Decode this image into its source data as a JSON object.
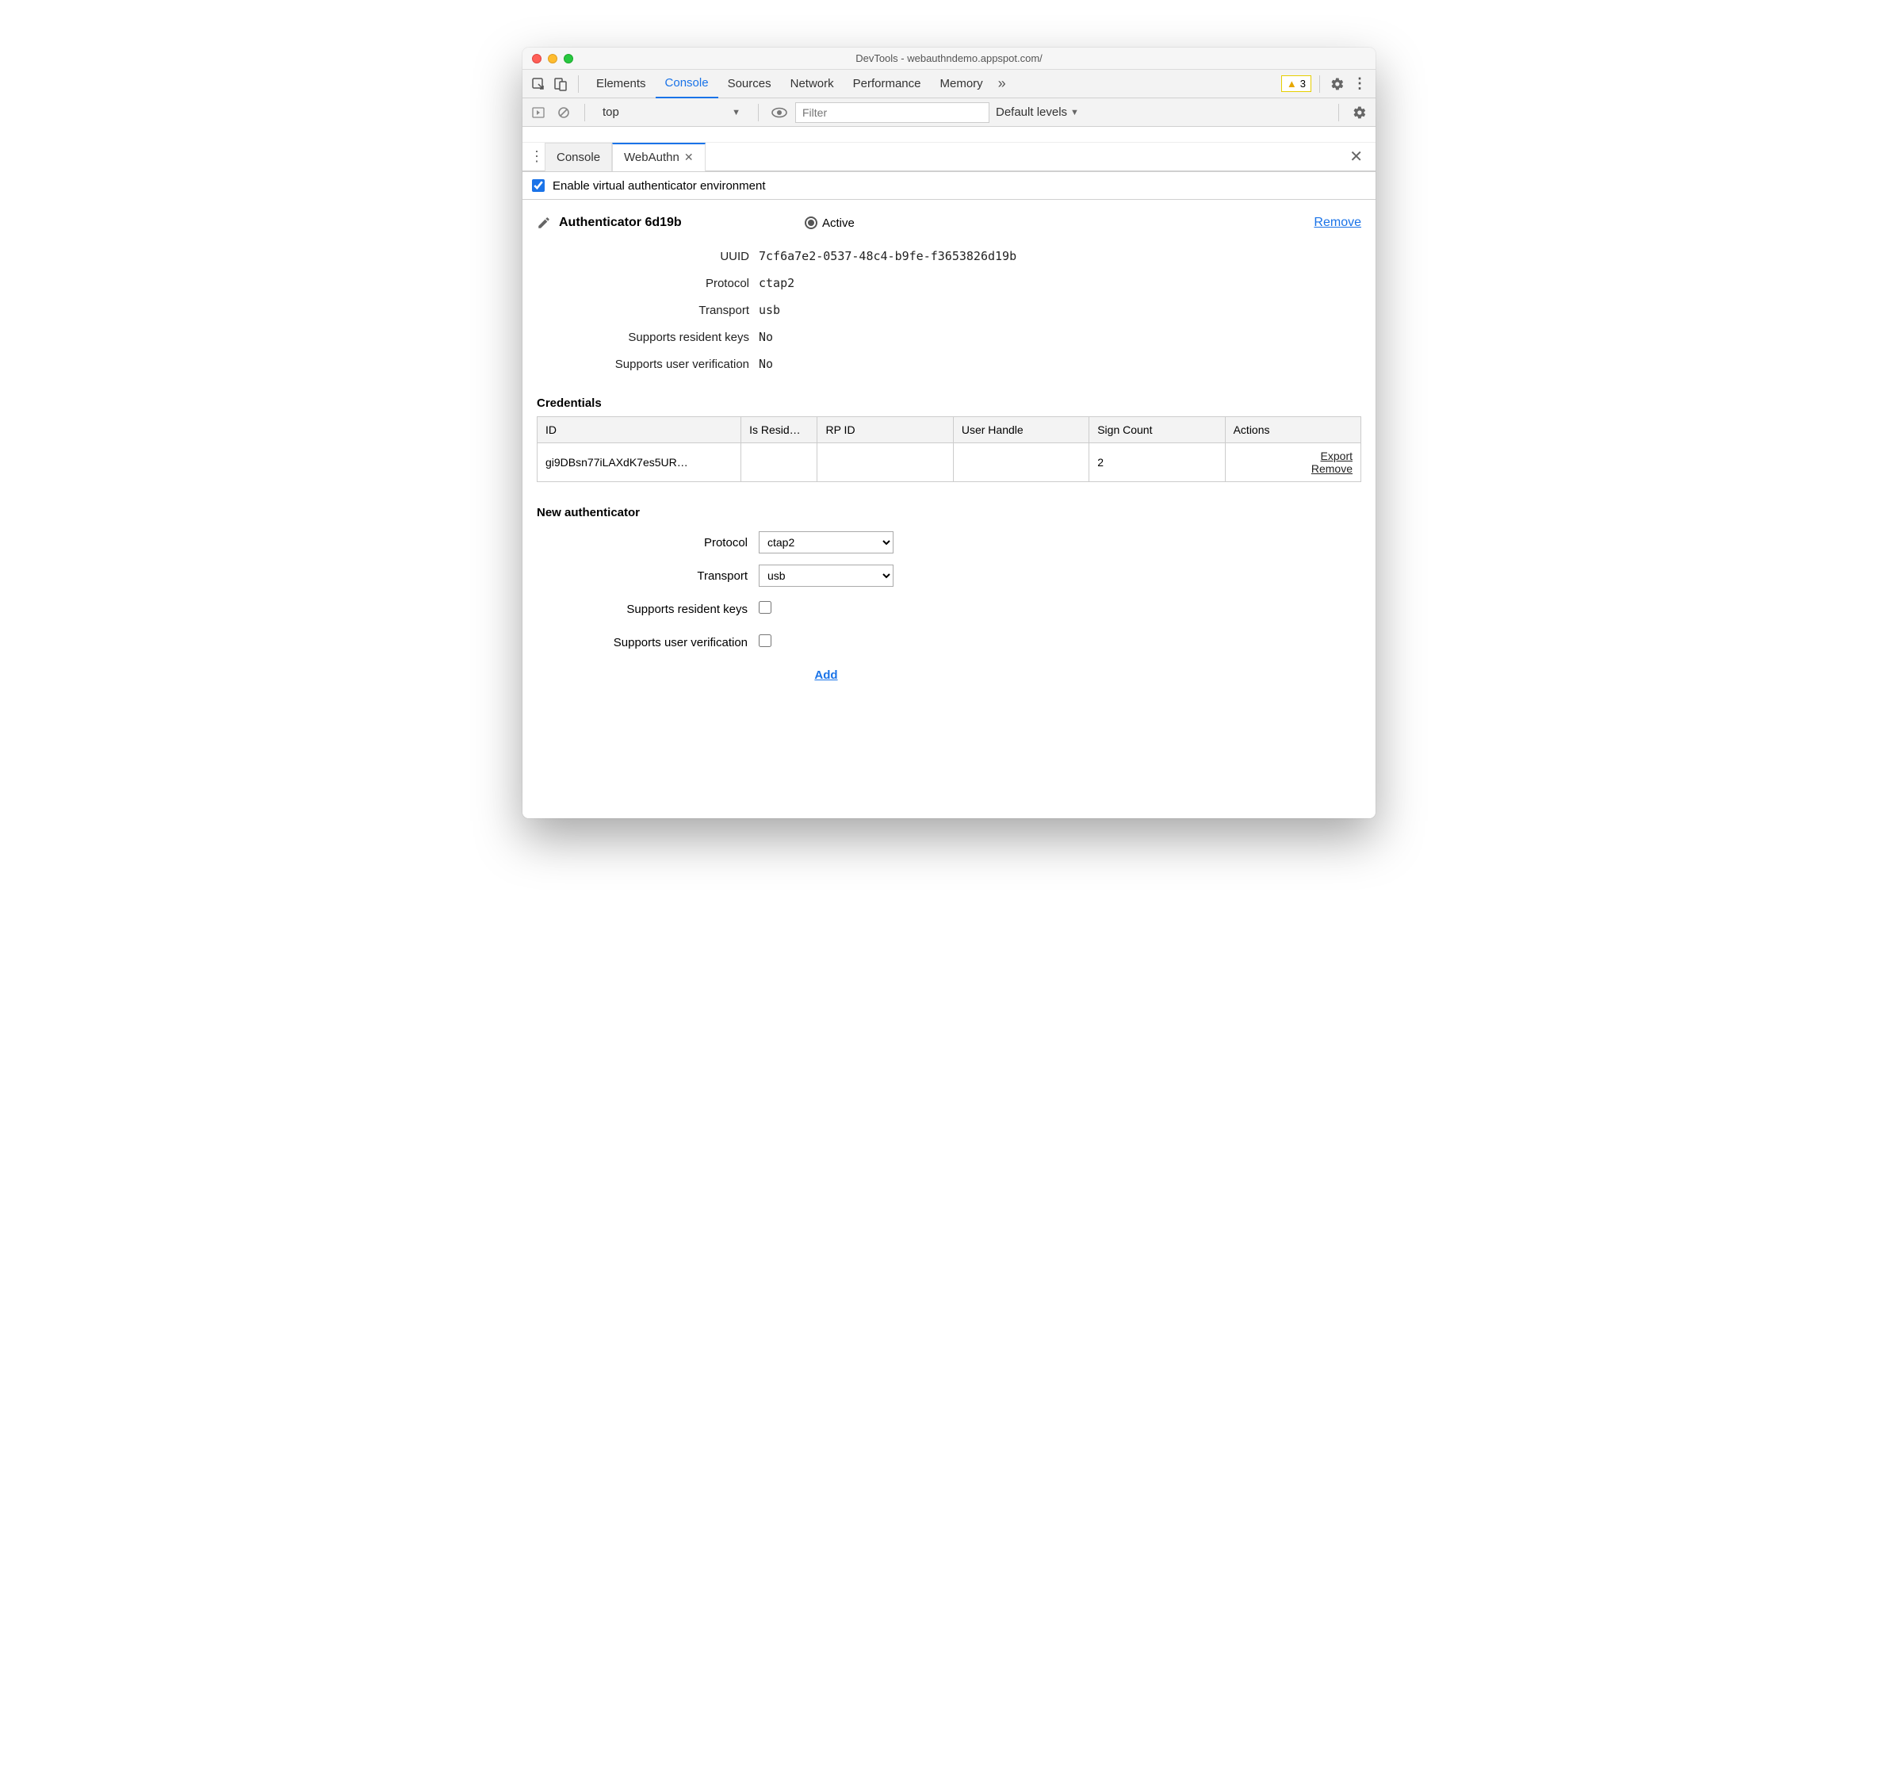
{
  "window": {
    "title": "DevTools - webauthndemo.appspot.com/"
  },
  "main_tabs": [
    "Elements",
    "Console",
    "Sources",
    "Network",
    "Performance",
    "Memory"
  ],
  "main_tab_active_index": 1,
  "issues_count": "3",
  "console_bar": {
    "context": "top",
    "filter_placeholder": "Filter",
    "levels": "Default levels"
  },
  "drawer": {
    "tabs": [
      "Console",
      "WebAuthn"
    ],
    "active_index": 1
  },
  "enable_checkbox": {
    "label": "Enable virtual authenticator environment",
    "checked": true
  },
  "authenticator": {
    "title": "Authenticator 6d19b",
    "active_label": "Active",
    "remove_label": "Remove",
    "details": [
      {
        "label": "UUID",
        "value": "7cf6a7e2-0537-48c4-b9fe-f3653826d19b"
      },
      {
        "label": "Protocol",
        "value": "ctap2"
      },
      {
        "label": "Transport",
        "value": "usb"
      },
      {
        "label": "Supports resident keys",
        "value": "No"
      },
      {
        "label": "Supports user verification",
        "value": "No"
      }
    ]
  },
  "credentials": {
    "title": "Credentials",
    "headers": [
      "ID",
      "Is Resid…",
      "RP ID",
      "User Handle",
      "Sign Count",
      "Actions"
    ],
    "row": {
      "id": "gi9DBsn77iLAXdK7es5UR…",
      "is_resident": "",
      "rp_id": "",
      "user_handle": "",
      "sign_count": "2",
      "actions": {
        "export": "Export",
        "remove": "Remove"
      }
    }
  },
  "new_auth": {
    "title": "New authenticator",
    "protocol_label": "Protocol",
    "protocol_value": "ctap2",
    "transport_label": "Transport",
    "transport_value": "usb",
    "resident_label": "Supports resident keys",
    "userverify_label": "Supports user verification",
    "add_label": "Add"
  }
}
